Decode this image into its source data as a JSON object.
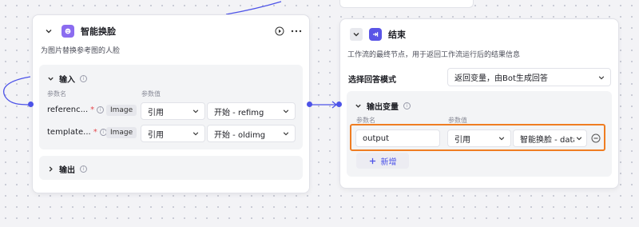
{
  "left_node": {
    "title": "智能换脸",
    "description": "为图片替换参考图的人脸",
    "input_section": {
      "title": "输入",
      "col_name": "参数名",
      "col_value": "参数值",
      "rows": [
        {
          "name": "referenc...",
          "type": "Image",
          "ref": "引用",
          "value": "开始 - refimg"
        },
        {
          "name": "template...",
          "type": "Image",
          "ref": "引用",
          "value": "开始 - oldimg"
        }
      ]
    },
    "output_section": {
      "title": "输出"
    }
  },
  "right_node": {
    "title": "结束",
    "description": "工作流的最终节点，用于返回工作流运行后的结果信息",
    "mode_label": "选择回答模式",
    "mode_value": "返回变量，由Bot生成回答",
    "output_section": {
      "title": "输出变量",
      "col_name": "参数名",
      "col_value": "参数值",
      "rows": [
        {
          "name": "output",
          "ref": "引用",
          "value": "智能换脸 - data"
        }
      ],
      "add_label": "新增"
    }
  },
  "colors": {
    "accent": "#4d53e8",
    "highlight": "#ef7d22",
    "face_icon": "#8b6cf0",
    "end_icon": "#5a55e6"
  }
}
